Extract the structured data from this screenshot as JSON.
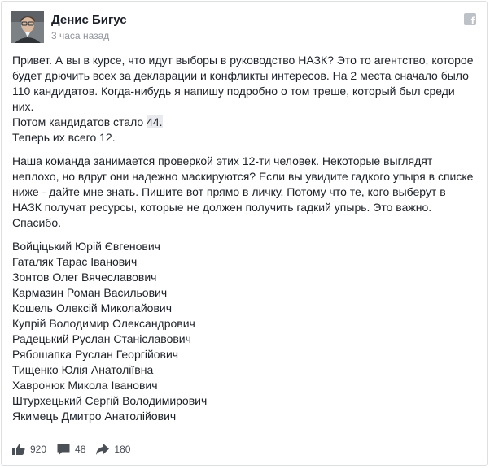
{
  "post": {
    "author": "Денис Бигус",
    "timestamp": "3 часа назад",
    "facebook_icon": "f",
    "paragraph1": {
      "text": "Привет. А вы в курсе, что идут выборы в руководство НАЗК? Это то агентство, которое будет дрючить всех за декларации и конфликты интересов. На 2 места сначало было 110 кандидатов. Когда-нибудь я напишу подробно о том треше, который был среди них.",
      "line2_prefix": "Потом кандидатов стало ",
      "line2_highlight": "44.",
      "line3": "Теперь их всего 12."
    },
    "paragraph2": "Наша команда занимается проверкой этих 12-ти человек. Некоторые выглядят неплохо, но вдруг они надежно маскируются? Если вы увидите гадкого упыря в списке ниже - дайте мне знать. Пишите вот прямо в личку. Потому что те, кого выберут в НАЗК получат ресурсы, которые не должен получить гадкий упырь. Это важно. Спасибо.",
    "names": [
      "Войціцький Юрій Євгенович",
      "Гаталяк Тарас Іванович",
      "Зонтов Олег Вячеславович",
      "Кармазин Роман Васильович",
      "Кошель Олексій Миколайович",
      "Купрій Володимир Олександрович",
      "Радецький Руслан Станіславович",
      "Рябошапка Руслан Георгійович",
      "Тищенко Юлія Анатоліївна",
      "Хавронюк Микола Іванович",
      "Штурхецький Сергій Володимирович",
      "Якимець Дмитро Анатолійович"
    ]
  },
  "footer": {
    "likes": "920",
    "comments": "48",
    "shares": "180"
  },
  "icons": {
    "like": "thumbs-up-icon",
    "comment": "comment-icon",
    "share": "share-arrow-icon"
  },
  "colors": {
    "text": "#1d2129",
    "meta": "#90949c",
    "footer": "#4b4f56",
    "highlight": "#e9eaed",
    "border": "#dddfe2"
  }
}
